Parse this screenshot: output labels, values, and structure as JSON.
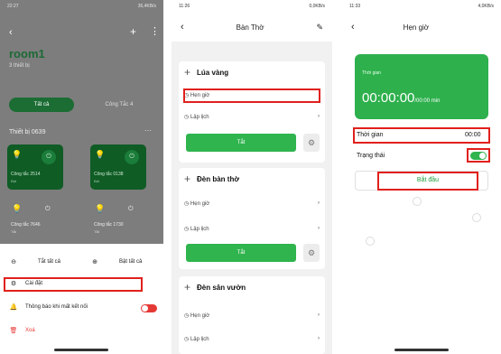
{
  "screen1": {
    "status_time": "22:27",
    "status_right": "36,4KB/s",
    "room_name": "room1",
    "device_count": "3 thiết bị",
    "tab_all": "Tất cả",
    "tab_switch": "Công Tắc 4",
    "device_group": "Thiết bị 0639",
    "tiles": [
      {
        "label": "Công tắc 2514",
        "sub": "Bật"
      },
      {
        "label": "Công tắc 0138",
        "sub": "Bật"
      },
      {
        "label": "Công tắc 7646",
        "sub": "Tắt"
      },
      {
        "label": "Công tắc 1730",
        "sub": "Tắt"
      }
    ],
    "sheet": {
      "all_off": "Tắt tất cả",
      "all_on": "Bật tất cả",
      "settings": "Cài đặt",
      "notify": "Thông báo khi mất kết nối",
      "delete": "Xoá"
    },
    "colors": {
      "toggle_on": "#e53935",
      "accent": "#2fb44e",
      "delete": "#e53935"
    }
  },
  "screen2": {
    "status_time": "11:26",
    "status_right": "0,0KB/s",
    "title": "Bàn Thờ",
    "cards": [
      {
        "name": "Lúa vàng",
        "timer": "Hẹn giờ",
        "schedule": "Lập lịch",
        "button": "Tắt"
      },
      {
        "name": "Đèn bàn thờ",
        "timer": "Hẹn giờ",
        "schedule": "Lập lịch",
        "button": "Tắt"
      },
      {
        "name": "Đèn sân vườn",
        "timer": "Hẹn giờ",
        "schedule": "Lập lịch"
      }
    ]
  },
  "screen3": {
    "status_time": "11:33",
    "status_right": "4,0KB/s",
    "title": "Hẹn giờ",
    "card_label": "Thời gian",
    "timer_value": "00:00:00",
    "timer_suffix": "/00:00 min",
    "time_label": "Thời gian",
    "time_value": "00:00",
    "status_label": "Trạng thái",
    "start_button": "Bắt đầu"
  }
}
